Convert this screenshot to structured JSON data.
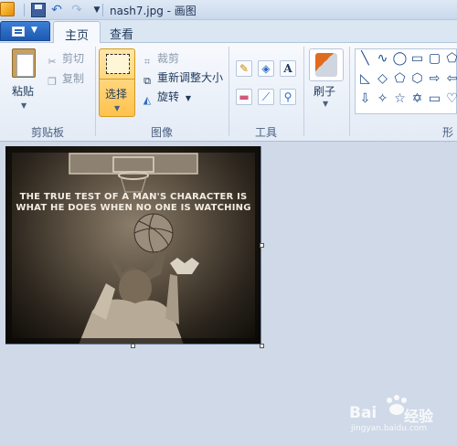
{
  "window": {
    "title": "nash7.jpg - 画图"
  },
  "quick_access": {
    "save": "save-icon",
    "undo": "undo-icon",
    "redo": "redo-icon"
  },
  "tabs": [
    {
      "label": "主页",
      "active": true
    },
    {
      "label": "查看",
      "active": false
    }
  ],
  "ribbon": {
    "clipboard": {
      "paste_label": "粘贴",
      "cut_label": "剪切",
      "copy_label": "复制",
      "group_label": "剪贴板"
    },
    "image": {
      "select_label": "选择",
      "crop_label": "裁剪",
      "resize_label": "重新调整大小",
      "rotate_label": "旋转",
      "group_label": "图像"
    },
    "tools": {
      "group_label": "工具",
      "items": [
        "pencil-icon",
        "fill-icon",
        "text-icon",
        "eraser-icon",
        "color-picker-icon",
        "magnifier-icon"
      ]
    },
    "brushes": {
      "label": "刷子"
    },
    "shapes": {
      "group_label": "形状"
    }
  },
  "canvas": {
    "image_text_line1": "THE TRUE TEST OF A MAN'S CHARACTER IS",
    "image_text_line2": "WHAT HE DOES WHEN NO ONE IS WATCHING"
  },
  "watermark": {
    "brand": "Bai",
    "brand2": "经验",
    "url": "jingyan.baidu.com"
  },
  "colors": {
    "accent_select": "#ffc24d",
    "app_menu": "#1d58b0",
    "workspace": "#cfd9e8"
  }
}
